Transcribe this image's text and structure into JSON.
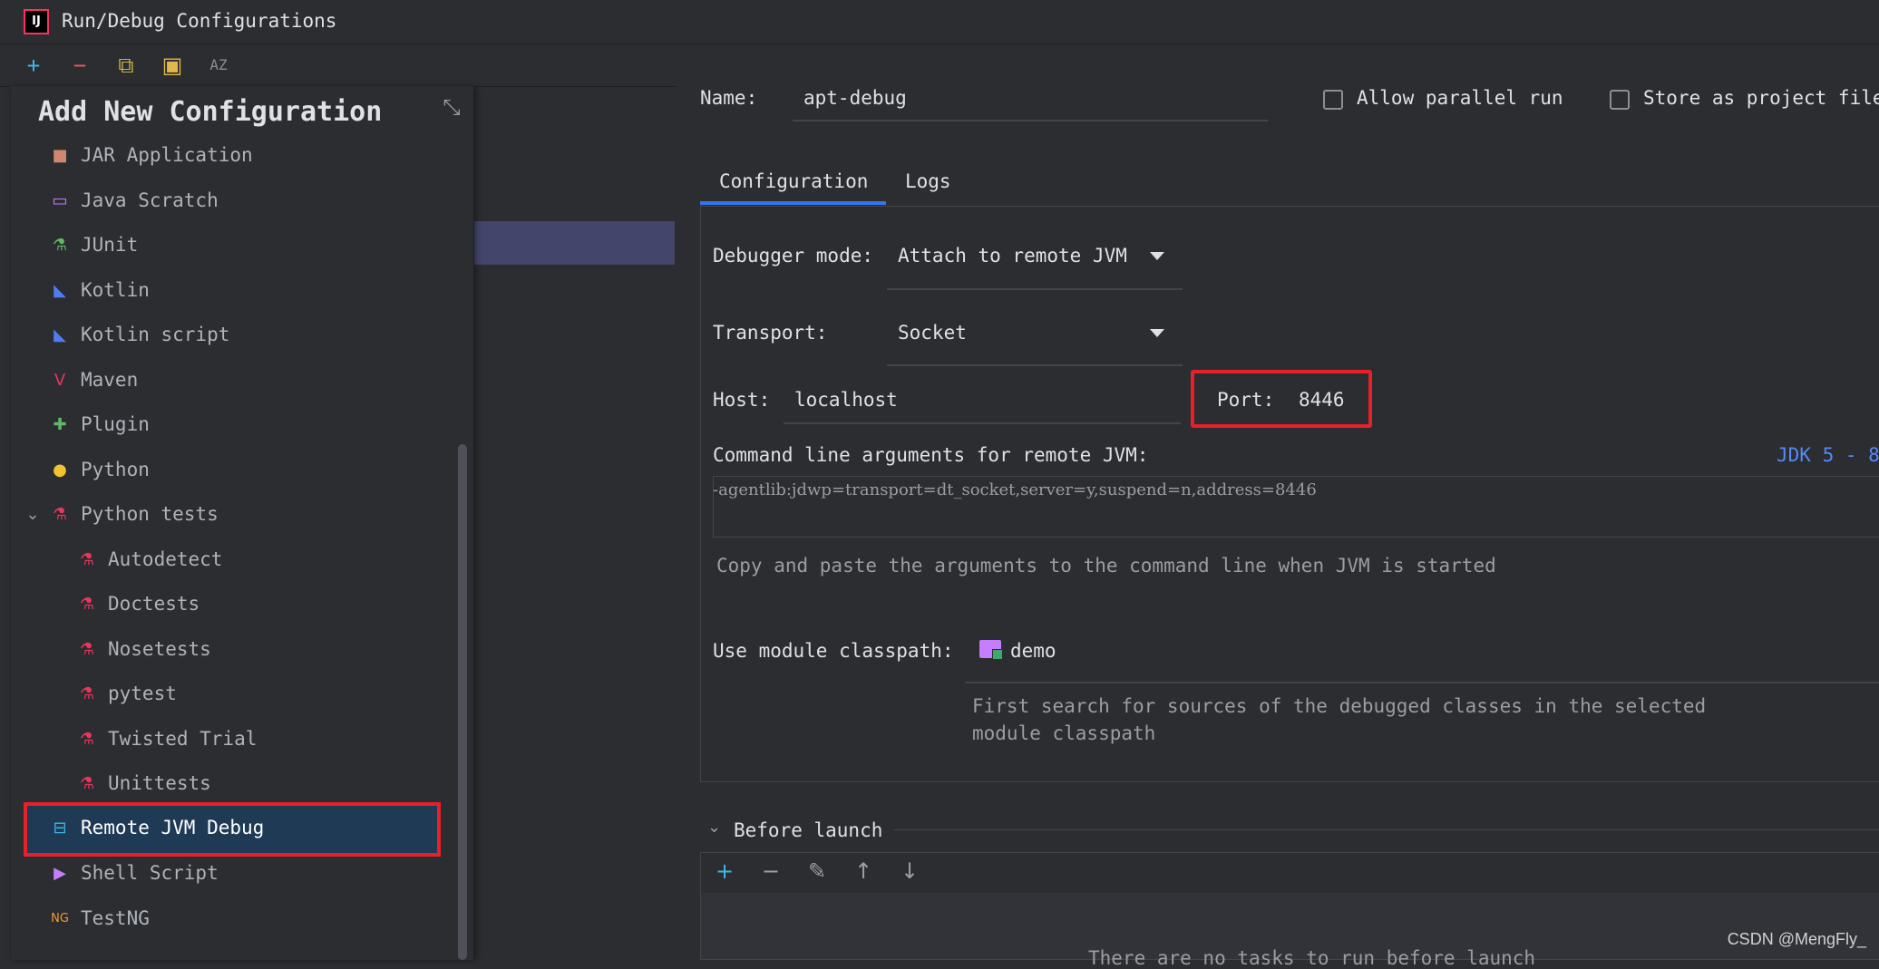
{
  "window": {
    "title": "Run/Debug Configurations",
    "logo": "IJ"
  },
  "toolbar": {
    "add": "+",
    "remove": "−",
    "copy": "⧉",
    "folder": "▣",
    "sort": "AZ"
  },
  "popup": {
    "title": "Add New Configuration",
    "items": [
      {
        "label": "JAR Application",
        "icon": "jar-icon",
        "glyph": "■",
        "color": "#d08770",
        "indent": 0
      },
      {
        "label": "Java Scratch",
        "icon": "java-scratch-icon",
        "glyph": "▭",
        "color": "#c77dff",
        "indent": 0
      },
      {
        "label": "JUnit",
        "icon": "junit-icon",
        "glyph": "⚗",
        "color": "#5fb865",
        "indent": 0
      },
      {
        "label": "Kotlin",
        "icon": "kotlin-icon",
        "glyph": "◣",
        "color": "#4f7cf0",
        "indent": 0
      },
      {
        "label": "Kotlin script",
        "icon": "kotlin-script-icon",
        "glyph": "◣",
        "color": "#4f7cf0",
        "indent": 0
      },
      {
        "label": "Maven",
        "icon": "maven-icon",
        "glyph": "V",
        "color": "#e8365d",
        "indent": 0
      },
      {
        "label": "Plugin",
        "icon": "plugin-icon",
        "glyph": "✚",
        "color": "#5fb865",
        "indent": 0
      },
      {
        "label": "Python",
        "icon": "python-icon",
        "glyph": "●",
        "color": "#f2c230",
        "indent": 0
      },
      {
        "label": "Python tests",
        "icon": "python-tests-icon",
        "glyph": "⚗",
        "color": "#e8365d",
        "indent": 0,
        "expanded": true
      },
      {
        "label": "Autodetect",
        "icon": "python-test-icon",
        "glyph": "⚗",
        "color": "#e8365d",
        "indent": 1
      },
      {
        "label": "Doctests",
        "icon": "python-test-icon",
        "glyph": "⚗",
        "color": "#e8365d",
        "indent": 1
      },
      {
        "label": "Nosetests",
        "icon": "python-test-icon",
        "glyph": "⚗",
        "color": "#e8365d",
        "indent": 1
      },
      {
        "label": "pytest",
        "icon": "python-test-icon",
        "glyph": "⚗",
        "color": "#e8365d",
        "indent": 1
      },
      {
        "label": "Twisted Trial",
        "icon": "python-test-icon",
        "glyph": "⚗",
        "color": "#e8365d",
        "indent": 1
      },
      {
        "label": "Unittests",
        "icon": "python-test-icon",
        "glyph": "⚗",
        "color": "#e8365d",
        "indent": 1
      },
      {
        "label": "Remote JVM Debug",
        "icon": "remote-debug-icon",
        "glyph": "⊟",
        "color": "#3fb6e8",
        "indent": 0,
        "selected": true
      },
      {
        "label": "Shell Script",
        "icon": "shell-script-icon",
        "glyph": "▶",
        "color": "#c77dff",
        "indent": 0
      },
      {
        "label": "TestNG",
        "icon": "testng-icon",
        "glyph": "NG",
        "color": "#f29b30",
        "indent": 0
      }
    ]
  },
  "config": {
    "name_label": "Name:",
    "name_value": "apt-debug",
    "allow_parallel": "Allow parallel run",
    "store_project": "Store as project file",
    "tabs": [
      "Configuration",
      "Logs"
    ],
    "debugger_mode_label": "Debugger mode:",
    "debugger_mode_value": "Attach to remote JVM",
    "transport_label": "Transport:",
    "transport_value": "Socket",
    "host_label": "Host:",
    "host_value": "localhost",
    "port_label": "Port:",
    "port_value": "8446",
    "cmd_label": "Command line arguments for remote JVM:",
    "jdk_link": "JDK 5 - 8",
    "cmd_value": "-agentlib:jdwp=transport=dt_socket,server=y,suspend=n,address=8446",
    "cmd_hint": "Copy and paste the arguments to the command line when JVM is started",
    "classpath_label": "Use module classpath:",
    "classpath_value": "demo",
    "classpath_hint_1": "First search for sources of the debugged classes in the selected",
    "classpath_hint_2": "module classpath",
    "before_launch": "Before launch",
    "no_tasks": "There are no tasks to run before launch"
  },
  "watermark": "CSDN @MengFly_",
  "colors": {
    "accent": "#3574f0",
    "highlight": "#e8202a",
    "add": "#3fb6e8",
    "remove": "#e55765"
  }
}
